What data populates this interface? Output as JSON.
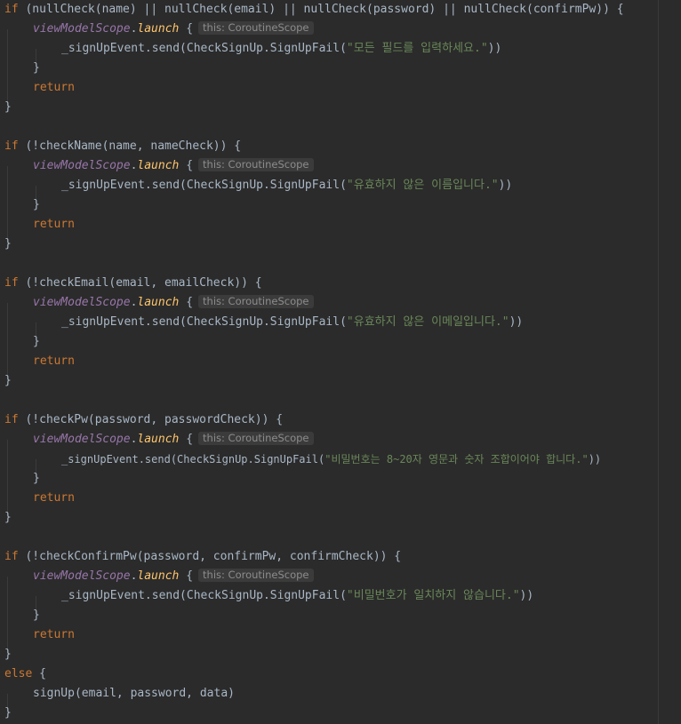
{
  "code": {
    "block1": {
      "if_line": "if (nullCheck(name) || nullCheck(email) || nullCheck(password) || nullCheck(confirmPw)) {",
      "message": "\"모든 필드를 입력하세요.\""
    },
    "block2": {
      "if_line": "if (!checkName(name, nameCheck)) {",
      "message": "\"유효하지 않은 이름입니다.\""
    },
    "block3": {
      "if_line": "if (!checkEmail(email, emailCheck)) {",
      "message": "\"유효하지 않은 이메일입니다.\""
    },
    "block4": {
      "if_line": "if (!checkPw(password, passwordCheck)) {",
      "message": "\"비밀번호는 8~20자 영문과 숫자 조합이어야 합니다.\""
    },
    "block5": {
      "if_line": "if (!checkConfirmPw(password, confirmPw, confirmCheck)) {",
      "message": "\"비밀번호가 일치하지 않습니다.\""
    },
    "launch_scope": "viewModelScope",
    "launch_call": "launch",
    "brace_open": " {",
    "hint": "this: CoroutineScope",
    "send_prefix": "_signUpEvent.send(CheckSignUp.SignUpFail(",
    "send_suffix": "))",
    "close_brace": "}",
    "return_kw": "return",
    "else_kw": "else",
    "signup_call": "signUp(email, password, data)"
  },
  "colors": {
    "background": "#2b2b2b",
    "keyword": "#cc7832",
    "property": "#9876aa",
    "function": "#ffc66d",
    "string": "#6a8759",
    "text": "#a9b7c6"
  }
}
